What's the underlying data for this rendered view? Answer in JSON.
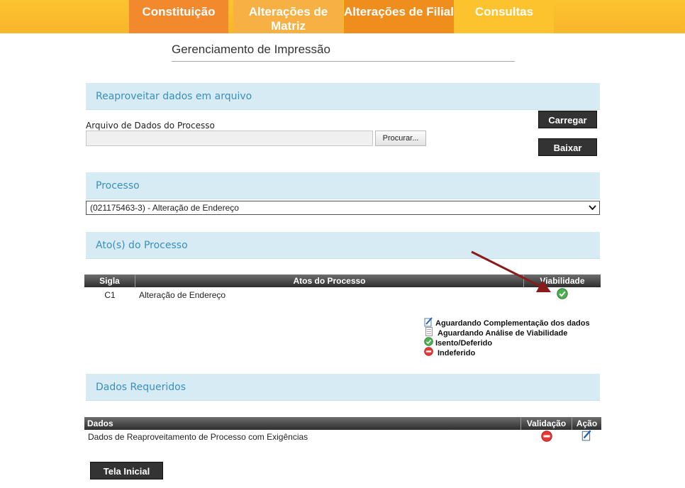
{
  "nav": {
    "tabs": [
      {
        "label": "Constituição",
        "color": "#f28a2d"
      },
      {
        "label": "Alterações de Matriz",
        "color": "#f7b043"
      },
      {
        "label": "Alterações de Filial",
        "color": "#ef8d1d"
      },
      {
        "label": "Consultas",
        "color": "#fcc32f"
      }
    ]
  },
  "page": {
    "title": "Gerenciamento de Impressão"
  },
  "reuse": {
    "header": "Reaproveitar dados em arquivo",
    "file_label": "Arquivo de Dados do Processo",
    "file_value": "",
    "browse_label": "Procurar...",
    "load_label": "Carregar",
    "download_label": "Baixar"
  },
  "process": {
    "header": "Processo",
    "selected": "(021175463-3) - Alteração de Endereço"
  },
  "acts": {
    "header": "Ato(s) do Processo",
    "columns": {
      "sigla": "Sigla",
      "atos": "Atos do Processo",
      "viabilidade": "Viabilidade"
    },
    "rows": [
      {
        "sigla": "C1",
        "ato": "Alteração de Endereço",
        "status_icon": "check-circle-icon"
      }
    ]
  },
  "legend": {
    "items": [
      {
        "icon": "edit-document-icon",
        "label": "Aguardando Complementação dos dados"
      },
      {
        "icon": "document-pending-icon",
        "label": "Aguardando Análise de Viabilidade"
      },
      {
        "icon": "check-circle-icon",
        "label": "Isento/Deferido"
      },
      {
        "icon": "minus-circle-icon",
        "label": "Indeferido"
      }
    ]
  },
  "required": {
    "header": "Dados Requeridos",
    "columns": {
      "dados": "Dados",
      "validacao": "Validação",
      "acao": "Ação"
    },
    "rows": [
      {
        "dados": "Dados de Reaproveitamento de Processo com Exigências",
        "validation_icon": "minus-circle-icon",
        "action_icon": "edit-document-icon"
      }
    ]
  },
  "footer": {
    "home_label": "Tela Inicial"
  },
  "colors": {
    "section_bg": "#d7ebf5",
    "section_text": "#3a8fbd",
    "arrow": "#8b1a1a",
    "ok_green": "#4caf50",
    "deny_red": "#e53935"
  }
}
